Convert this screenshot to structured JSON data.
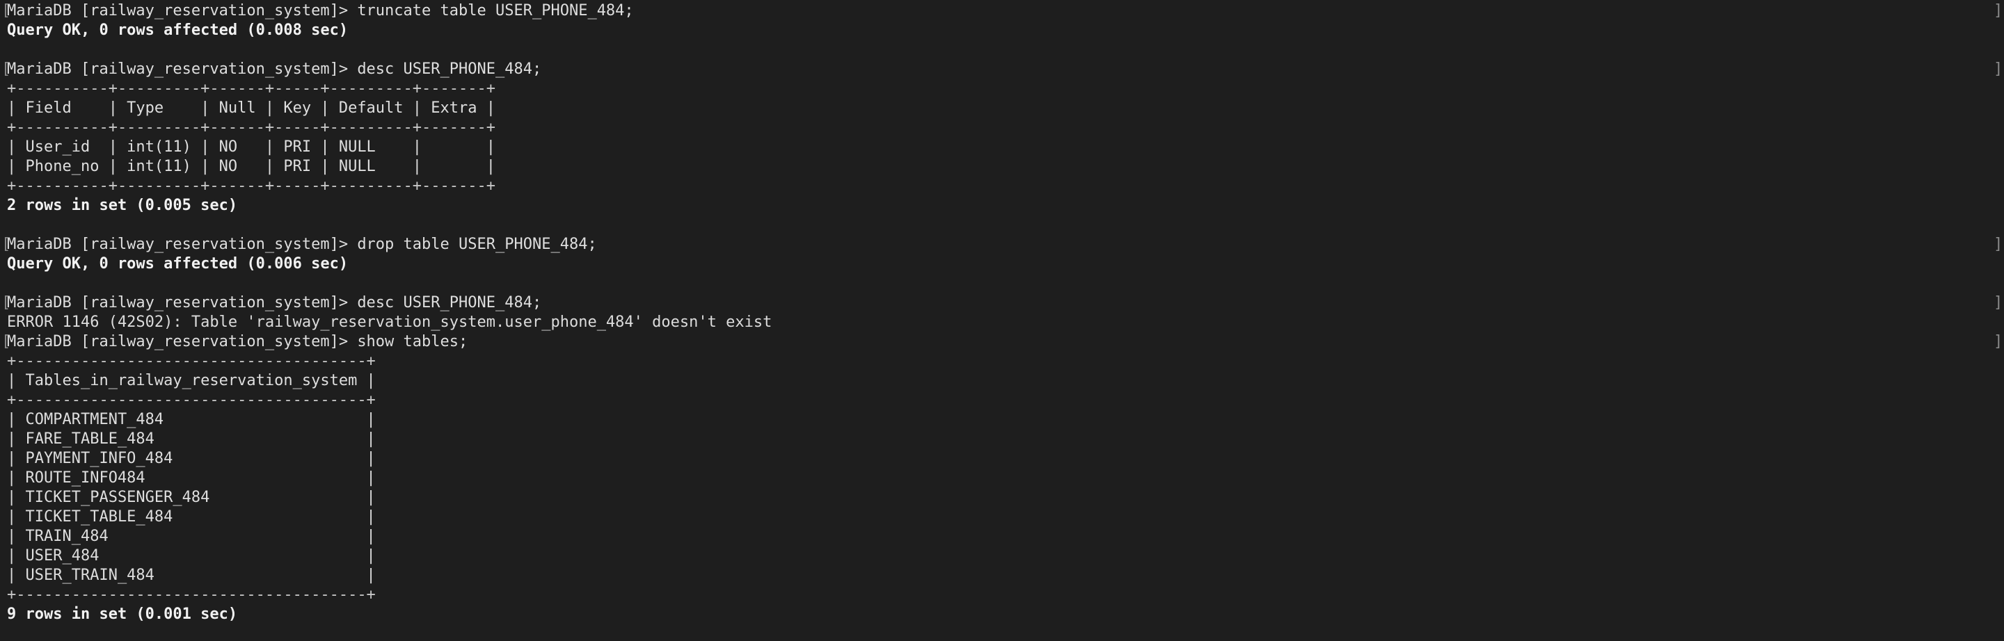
{
  "terminal": {
    "marker_left": "[",
    "marker_right": "]",
    "lines": [
      {
        "text": "MariaDB [railway_reservation_system]> truncate table USER_PHONE_484;",
        "kind": "prompt"
      },
      {
        "text": "Query OK, 0 rows affected (0.008 sec)",
        "kind": "bold"
      },
      {
        "text": "",
        "kind": "blank"
      },
      {
        "text": "MariaDB [railway_reservation_system]> desc USER_PHONE_484;",
        "kind": "prompt"
      },
      {
        "text": "+----------+---------+------+-----+---------+-------+",
        "kind": "border"
      },
      {
        "text": "| Field    | Type    | Null | Key | Default | Extra |",
        "kind": "table"
      },
      {
        "text": "+----------+---------+------+-----+---------+-------+",
        "kind": "border"
      },
      {
        "text": "| User_id  | int(11) | NO   | PRI | NULL    |       |",
        "kind": "table"
      },
      {
        "text": "| Phone_no | int(11) | NO   | PRI | NULL    |       |",
        "kind": "table"
      },
      {
        "text": "+----------+---------+------+-----+---------+-------+",
        "kind": "border"
      },
      {
        "text": "2 rows in set (0.005 sec)",
        "kind": "bold"
      },
      {
        "text": "",
        "kind": "blank"
      },
      {
        "text": "MariaDB [railway_reservation_system]> drop table USER_PHONE_484;",
        "kind": "prompt"
      },
      {
        "text": "Query OK, 0 rows affected (0.006 sec)",
        "kind": "bold"
      },
      {
        "text": "",
        "kind": "blank"
      },
      {
        "text": "MariaDB [railway_reservation_system]> desc USER_PHONE_484;",
        "kind": "prompt"
      },
      {
        "text": "ERROR 1146 (42S02): Table 'railway_reservation_system.user_phone_484' doesn't exist",
        "kind": "error"
      },
      {
        "text": "MariaDB [railway_reservation_system]> show tables;",
        "kind": "prompt"
      },
      {
        "text": "+--------------------------------------+",
        "kind": "border"
      },
      {
        "text": "| Tables_in_railway_reservation_system |",
        "kind": "table"
      },
      {
        "text": "+--------------------------------------+",
        "kind": "border"
      },
      {
        "text": "| COMPARTMENT_484                      |",
        "kind": "table"
      },
      {
        "text": "| FARE_TABLE_484                       |",
        "kind": "table"
      },
      {
        "text": "| PAYMENT_INFO_484                     |",
        "kind": "table"
      },
      {
        "text": "| ROUTE_INFO484                        |",
        "kind": "table"
      },
      {
        "text": "| TICKET_PASSENGER_484                 |",
        "kind": "table"
      },
      {
        "text": "| TICKET_TABLE_484                     |",
        "kind": "table"
      },
      {
        "text": "| TRAIN_484                            |",
        "kind": "table"
      },
      {
        "text": "| USER_484                             |",
        "kind": "table"
      },
      {
        "text": "| USER_TRAIN_484                       |",
        "kind": "table"
      },
      {
        "text": "+--------------------------------------+",
        "kind": "border"
      },
      {
        "text": "9 rows in set (0.001 sec)",
        "kind": "bold"
      }
    ]
  }
}
